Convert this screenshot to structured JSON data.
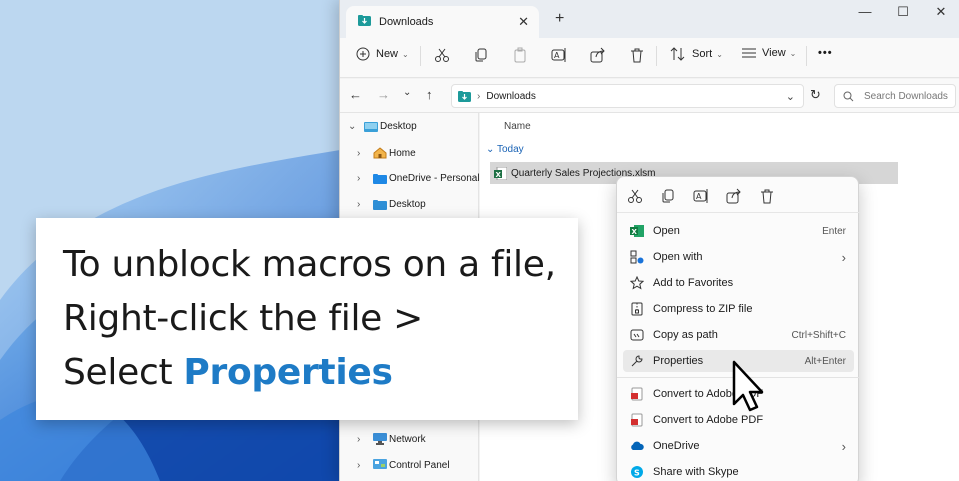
{
  "window": {
    "tab_title": "Downloads",
    "tab_close": "✕",
    "new_tab": "+",
    "minimize": "—",
    "maximize": "☐",
    "close": "✕"
  },
  "toolbar": {
    "new_label": "New",
    "sort_label": "Sort",
    "view_label": "View",
    "more_label": "•••"
  },
  "address": {
    "path": "Downloads",
    "search_placeholder": "Search Downloads"
  },
  "sidebar": {
    "items": [
      {
        "label": "Desktop"
      },
      {
        "label": "Home"
      },
      {
        "label": "OneDrive - Personal"
      },
      {
        "label": "Desktop"
      },
      {
        "label": "Network"
      },
      {
        "label": "Control Panel"
      }
    ]
  },
  "content": {
    "column_name": "Name",
    "group": "Today",
    "file_name": "Quarterly Sales Projections.xlsm"
  },
  "context_menu": {
    "items": [
      {
        "label": "Open",
        "shortcut": "Enter"
      },
      {
        "label": "Open with",
        "shortcut": "›"
      },
      {
        "label": "Add to Favorites",
        "shortcut": ""
      },
      {
        "label": "Compress to ZIP file",
        "shortcut": ""
      },
      {
        "label": "Copy as path",
        "shortcut": "Ctrl+Shift+C"
      },
      {
        "label": "Properties",
        "shortcut": "Alt+Enter"
      },
      {
        "label": "Convert to Adobe PDF",
        "shortcut": ""
      },
      {
        "label": "Convert to Adobe PDF",
        "shortcut": ""
      },
      {
        "label": "OneDrive",
        "shortcut": "›"
      },
      {
        "label": "Share with Skype",
        "shortcut": ""
      }
    ]
  },
  "caption": {
    "line1": "To unblock macros on a file,",
    "line2": "Right-click the file >",
    "line3_prefix": "Select ",
    "line3_highlight": "Properties"
  },
  "colors": {
    "accent": "#1e7bc6",
    "link": "#1a63b5",
    "excel_green": "#1d7044",
    "folder_teal": "#1d9a9a"
  }
}
